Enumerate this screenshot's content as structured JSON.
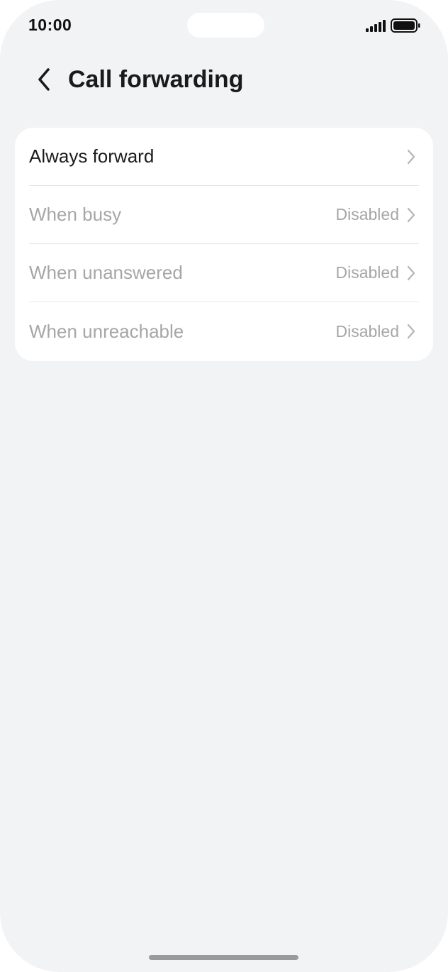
{
  "status_bar": {
    "time": "10:00",
    "icons": [
      "signal-icon",
      "battery-icon"
    ]
  },
  "header": {
    "back_icon": "chevron-left-icon",
    "title": "Call forwarding"
  },
  "forwarding_options": [
    {
      "label": "Always forward",
      "value": "",
      "enabled": true
    },
    {
      "label": "When busy",
      "value": "Disabled",
      "enabled": false
    },
    {
      "label": "When unanswered",
      "value": "Disabled",
      "enabled": false
    },
    {
      "label": "When unreachable",
      "value": "Disabled",
      "enabled": false
    }
  ],
  "colors": {
    "background": "#f2f3f5",
    "card": "#ffffff",
    "text_primary": "#1a1a1a",
    "text_disabled": "#a6a6a6",
    "chevron": "#b5b5b7"
  }
}
